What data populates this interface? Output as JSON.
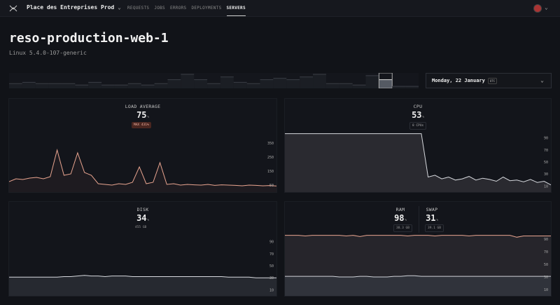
{
  "nav": {
    "project": "Place des Entreprises Prod",
    "links": [
      "REQUESTS",
      "JOBS",
      "ERRORS",
      "DEPLOYMENTS",
      "SERVERS"
    ],
    "active": "SERVERS"
  },
  "server": {
    "name": "reso-production-web-1",
    "os": "Linux 5.4.0-107-generic"
  },
  "date_picker": {
    "label": "Monday, 22 January",
    "tz": "UTC"
  },
  "colors": {
    "accent": "#e8a48f",
    "line": "#cfd2d8",
    "bg": "#111318"
  },
  "icons": {
    "logo": "logo-icon",
    "project_chevron": "chevron-down-icon",
    "date_chevron": "chevron-down-icon",
    "user": "avatar"
  },
  "panels": {
    "load": {
      "title": "LOAD AVERAGE",
      "value": "75",
      "unit": "%",
      "badge": "MAX 431%"
    },
    "cpu": {
      "title": "CPU",
      "value": "53",
      "unit": "%",
      "badge": "8 CPUs"
    },
    "disk": {
      "title": "DISK",
      "value": "34",
      "unit": "%",
      "badge": "455 GB"
    },
    "ram": {
      "title": "RAM",
      "value": "98",
      "unit": "%",
      "badge": "38.3 GB"
    },
    "swap": {
      "title": "SWAP",
      "value": "31",
      "unit": "%",
      "badge": "39.1 GB"
    }
  },
  "chart_data": [
    {
      "type": "bar",
      "name": "day-selector",
      "values": [
        3,
        4,
        3,
        3,
        3,
        2,
        4,
        2,
        2,
        3,
        2,
        3,
        6,
        10,
        6,
        3,
        8,
        4,
        3,
        6,
        7,
        6,
        8,
        10,
        3,
        3,
        2,
        9,
        6,
        1,
        1
      ],
      "selected_index": 28
    },
    {
      "type": "line",
      "id": "load",
      "yticks": [
        50,
        150,
        250,
        350
      ],
      "ylim": [
        0,
        400
      ],
      "values": [
        75,
        95,
        90,
        100,
        105,
        95,
        110,
        300,
        120,
        130,
        280,
        140,
        120,
        60,
        55,
        50,
        60,
        55,
        70,
        180,
        60,
        70,
        210,
        55,
        60,
        50,
        55,
        52,
        50,
        55,
        48,
        52,
        50,
        48,
        45,
        50,
        48,
        45,
        47,
        44
      ]
    },
    {
      "type": "area",
      "id": "cpu",
      "yticks": [
        10,
        30,
        50,
        70,
        90
      ],
      "ylim": [
        0,
        100
      ],
      "values": [
        97,
        97,
        97,
        97,
        97,
        97,
        97,
        97,
        97,
        97,
        97,
        97,
        97,
        97,
        97,
        97,
        97,
        97,
        97,
        97,
        97,
        25,
        28,
        22,
        25,
        20,
        22,
        26,
        20,
        23,
        21,
        18,
        25,
        19,
        20,
        17,
        21,
        16,
        18,
        12
      ]
    },
    {
      "type": "area",
      "id": "disk",
      "yticks": [
        10,
        30,
        50,
        70,
        90
      ],
      "ylim": [
        0,
        100
      ],
      "values": [
        31,
        31,
        31,
        31,
        31,
        31,
        31,
        31,
        32,
        32,
        33,
        34,
        33,
        33,
        32,
        33,
        33,
        33,
        32,
        32,
        32,
        32,
        32,
        32,
        32,
        32,
        32,
        32,
        32,
        32,
        32,
        32,
        31,
        31,
        31,
        31,
        30,
        30,
        30,
        30
      ]
    },
    {
      "type": "area",
      "id": "ram-swap",
      "yticks": [
        10,
        30,
        50,
        70,
        90
      ],
      "ylim": [
        0,
        100
      ],
      "series": [
        {
          "name": "RAM",
          "values": [
            96,
            96,
            96,
            95,
            96,
            96,
            96,
            96,
            96,
            95,
            96,
            94,
            96,
            96,
            96,
            96,
            96,
            96,
            95,
            96,
            96,
            96,
            95,
            96,
            96,
            96,
            96,
            95,
            96,
            96,
            96,
            96,
            96,
            96,
            93,
            95,
            95,
            95,
            95,
            95
          ]
        },
        {
          "name": "SWAP",
          "values": [
            31,
            31,
            31,
            31,
            31,
            31,
            31,
            31,
            30,
            30,
            30,
            31,
            31,
            30,
            30,
            30,
            31,
            31,
            32,
            32,
            31,
            31,
            31,
            31,
            31,
            31,
            31,
            31,
            31,
            31,
            31,
            31,
            31,
            31,
            31,
            31,
            31,
            31,
            31,
            31
          ]
        }
      ]
    }
  ]
}
